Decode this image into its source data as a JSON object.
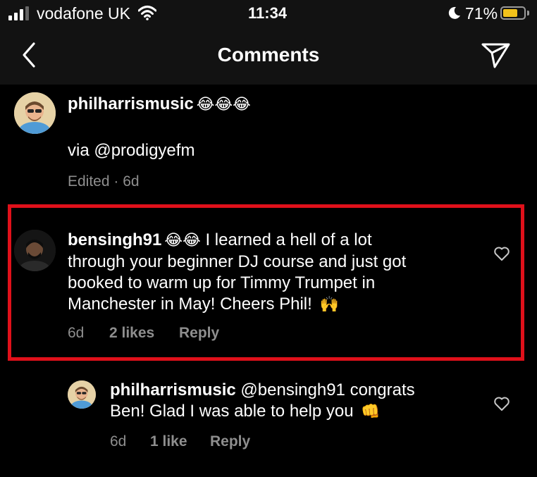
{
  "status_bar": {
    "carrier": "vodafone UK",
    "time": "11:34",
    "battery_percent": "71%",
    "battery_level": 0.71,
    "icons": [
      "signal-icon",
      "wifi-icon",
      "moon-icon",
      "battery-icon"
    ]
  },
  "header": {
    "title": "Comments",
    "back_icon": "chevron-left-icon",
    "share_icon": "direct-send-icon"
  },
  "comments": [
    {
      "username": "philharrismusic",
      "emoji": "😂😂😂",
      "text": "via @prodigyefm",
      "meta_time": "Edited · 6d"
    },
    {
      "username": "bensingh91",
      "emoji": "😂😂",
      "lines": [
        "I learned a hell of a lot",
        "through your beginner DJ course and just got",
        "booked to warm up for Timmy Trumpet in",
        "Manchester in May! Cheers Phil!"
      ],
      "end_emoji": "🙌",
      "time": "6d",
      "likes": "2 likes",
      "reply": "Reply",
      "highlighted": true,
      "highlight_color": "#e0101a"
    },
    {
      "username": "philharrismusic",
      "mention": "@bensingh91",
      "lines": [
        "congrats",
        "Ben! Glad I was able to help you"
      ],
      "end_emoji": "👊",
      "time": "6d",
      "likes": "1 like",
      "reply": "Reply"
    }
  ]
}
